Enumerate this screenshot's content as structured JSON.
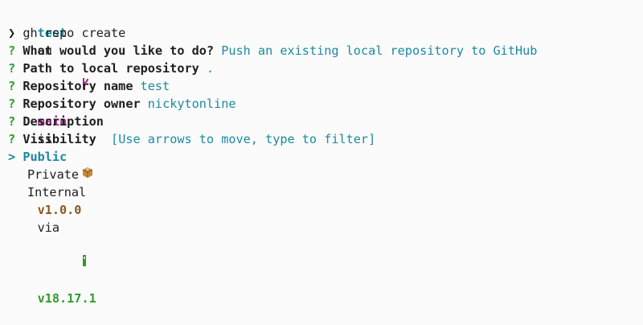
{
  "prompt": {
    "dir": "test",
    "on": "on",
    "branch_icon": "git-branch-icon",
    "branch": "main",
    "is": "is",
    "package_icon": "package-icon",
    "version": "v1.0.0",
    "via": "via",
    "node_icon": "node-icon",
    "node_version": "v18.17.1",
    "prompt_symbol": "❯",
    "command": "gh repo create"
  },
  "qa": [
    {
      "mark": "?",
      "question": "What would you like to do?",
      "answer": "Push an existing local repository to GitHub"
    },
    {
      "mark": "?",
      "question": "Path to local repository",
      "answer": "."
    },
    {
      "mark": "?",
      "question": "Repository name",
      "answer": "test"
    },
    {
      "mark": "?",
      "question": "Repository owner",
      "answer": "nickytonline"
    },
    {
      "mark": "?",
      "question": "Description",
      "answer": ""
    },
    {
      "mark": "?",
      "question": "Visibility",
      "answer": " [Use arrows to move, type to filter]"
    }
  ],
  "options": {
    "cursor": ">",
    "items": [
      "Public",
      "Private",
      "Internal"
    ],
    "selected_index": 0
  },
  "colors": {
    "background": "#fbfbfb",
    "teal": "#1b8aa0",
    "green": "#2e9a2e",
    "magenta": "#b0208f",
    "brown": "#8a5a1e"
  }
}
